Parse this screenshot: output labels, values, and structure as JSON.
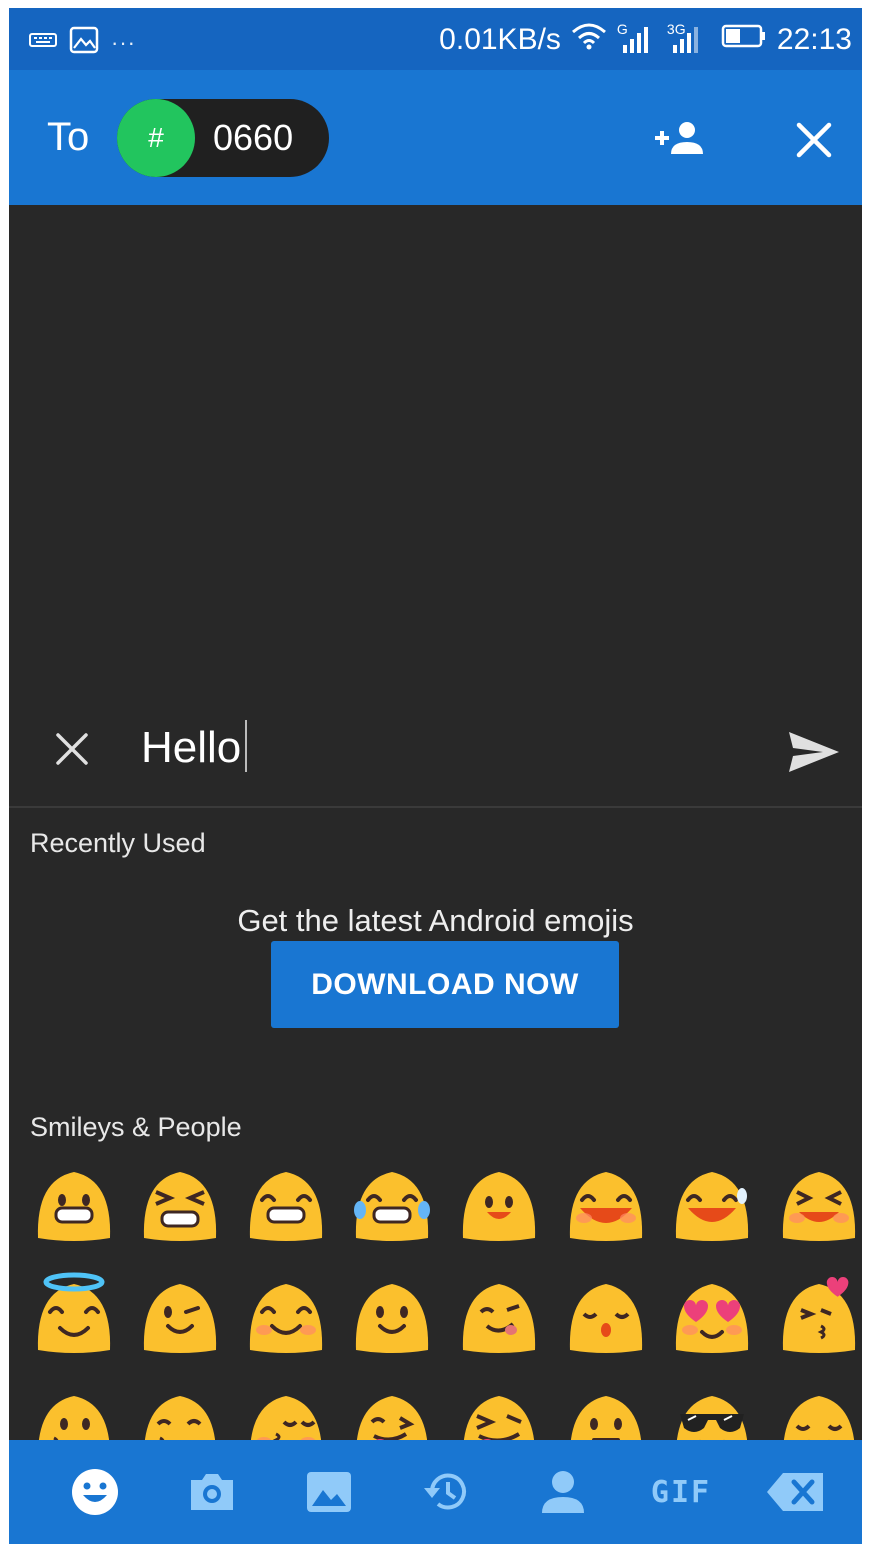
{
  "status_bar": {
    "speed": "0.01KB/s",
    "sim1_label": "G",
    "sim2_label": "3G",
    "time": "22:13",
    "overflow": "···"
  },
  "header": {
    "to_label": "To",
    "chip_symbol": "#",
    "chip_number": "0660"
  },
  "compose": {
    "text": "Hello"
  },
  "emoji_panel": {
    "recent_title": "Recently Used",
    "promo_text": "Get the latest Android emojis",
    "download_label": "DOWNLOAD NOW",
    "smileys_title": "Smileys & People",
    "emojis": [
      "grinning-face",
      "persevering-face",
      "beaming-face",
      "tears-of-joy-face",
      "smiling-face",
      "grinning-squinting-face",
      "grinning-sweat-face",
      "squinting-laughing-face",
      "smiling-face-with-halo",
      "winking-face",
      "smiling-eyes-face",
      "slightly-smiling-face",
      "face-savoring-food",
      "kissing-closed-eyes-face",
      "heart-eyes-face",
      "face-blowing-kiss",
      "kissing-face",
      "kissing-smiling-eyes-face",
      "kissing-blush-face",
      "winking-tongue-face",
      "squinting-tongue-face",
      "neutral-face",
      "sunglasses-face",
      "relieved-face"
    ]
  },
  "bottom_bar": {
    "gif_label": "GIF",
    "tabs": [
      "emoji-tab",
      "camera-tab",
      "gallery-tab",
      "recent-tab",
      "contact-tab",
      "gif-tab",
      "backspace-tab"
    ]
  },
  "colors": {
    "primary": "#1976d2",
    "status_bar": "#1565c0",
    "background": "#282828",
    "chip_accent": "#22c55e",
    "emoji_yellow": "#fbc02d",
    "inactive_icon": "#90caf9"
  }
}
